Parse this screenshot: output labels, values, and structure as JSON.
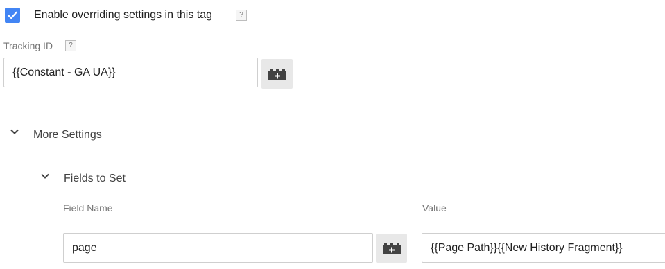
{
  "override": {
    "checked": true,
    "label": "Enable overriding settings in this tag",
    "help": "?"
  },
  "tracking": {
    "label": "Tracking ID",
    "help": "?",
    "value": "{{Constant - GA UA}}"
  },
  "more_settings": {
    "title": "More Settings",
    "expanded": true
  },
  "fields_to_set": {
    "title": "Fields to Set",
    "expanded": true,
    "columns": [
      "Field Name",
      "Value"
    ],
    "rows": [
      {
        "field_name": "page",
        "value": "{{Page Path}}{{New History Fragment}}"
      }
    ]
  },
  "icons": {
    "checkbox": "checkmark-icon",
    "variable_button": "variable-brick-icon",
    "expand": "chevron-down-icon"
  },
  "colors": {
    "checkbox_blue": "#4285f4",
    "button_grey": "#e8e8e8",
    "icon_dark": "#424242"
  }
}
